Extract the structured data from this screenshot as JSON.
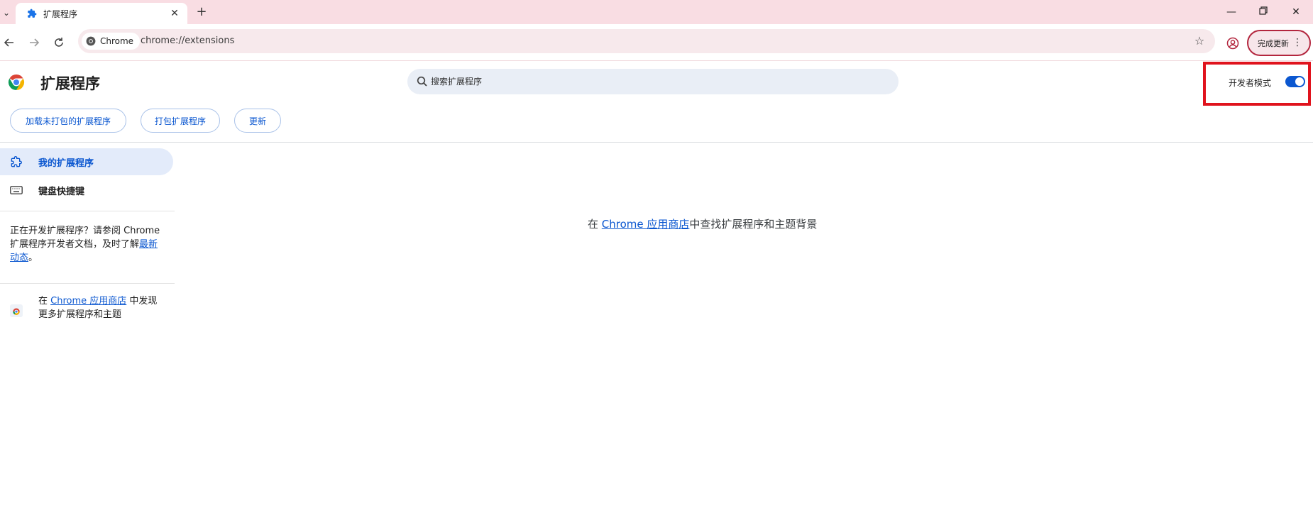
{
  "tab": {
    "title": "扩展程序"
  },
  "toolbar": {
    "chip_label": "Chrome",
    "url": "chrome://extensions",
    "update_label": "完成更新"
  },
  "header": {
    "title": "扩展程序",
    "search_placeholder": "搜索扩展程序",
    "dev_mode_label": "开发者模式",
    "dev_mode_enabled": true
  },
  "actions": {
    "load_unpacked": "加载未打包的扩展程序",
    "pack": "打包扩展程序",
    "update": "更新"
  },
  "sidebar": {
    "items": [
      {
        "label": "我的扩展程序",
        "icon": "extension-icon",
        "active": true
      },
      {
        "label": "键盘快捷键",
        "icon": "keyboard-icon",
        "active": false
      }
    ],
    "dev_text_1": "正在开发扩展程序？请参阅 Chrome 扩展程序开发者文档，及时了解",
    "dev_link": "最新动态",
    "dev_text_2": "。",
    "webstore_prefix": "在 ",
    "webstore_link": "Chrome 应用商店",
    "webstore_suffix": " 中发现更多扩展程序和主题"
  },
  "main": {
    "prefix": "在 ",
    "link": "Chrome 应用商店",
    "suffix": "中查找扩展程序和主题背景"
  },
  "colors": {
    "accent": "#0b57d0",
    "tabstrip": "#f9dde3",
    "highlight": "#e0131d"
  }
}
